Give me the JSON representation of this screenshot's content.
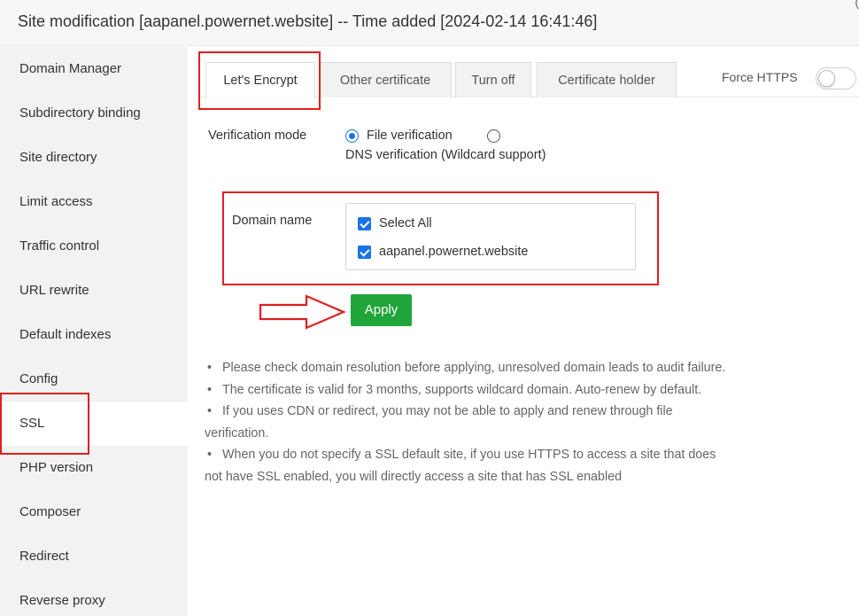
{
  "window": {
    "title": "Site modification [aapanel.powernet.website] -- Time added [2024-02-14 16:41:46]"
  },
  "sidebar": {
    "items": [
      {
        "label": "Domain Manager"
      },
      {
        "label": "Subdirectory binding"
      },
      {
        "label": "Site directory"
      },
      {
        "label": "Limit access"
      },
      {
        "label": "Traffic control"
      },
      {
        "label": "URL rewrite"
      },
      {
        "label": "Default indexes"
      },
      {
        "label": "Config"
      },
      {
        "label": "SSL",
        "active": true
      },
      {
        "label": "PHP version"
      },
      {
        "label": "Composer"
      },
      {
        "label": "Redirect"
      },
      {
        "label": "Reverse proxy"
      }
    ]
  },
  "tabs": [
    {
      "label": "Let's Encrypt",
      "active": true
    },
    {
      "label": "Other certificate"
    },
    {
      "label": "Turn off"
    },
    {
      "label": "Certificate holder"
    }
  ],
  "force_https": {
    "label": "Force HTTPS",
    "enabled": false
  },
  "verification": {
    "label": "Verification mode",
    "options": [
      {
        "label": "File verification",
        "checked": true
      },
      {
        "label": "DNS verification (Wildcard support)",
        "checked": false
      }
    ]
  },
  "domain": {
    "label": "Domain name",
    "options": [
      {
        "label": "Select All",
        "checked": true
      },
      {
        "label": "aapanel.powernet.website",
        "checked": true
      }
    ]
  },
  "apply_button": {
    "label": "Apply"
  },
  "notes": [
    "Please check domain resolution before applying, unresolved domain leads to audit failure.",
    "The certificate is valid for 3 months, supports wildcard domain. Auto-renew by default.",
    "If you uses CDN or redirect, you may not be able to apply and renew through file verification.",
    "When you do not specify a SSL default site, if you use HTTPS to access a site that does not have SSL enabled, you will directly access a site that has SSL enabled"
  ],
  "colors": {
    "accent_blue": "#1a73e8",
    "apply_green": "#20a53a",
    "annotation_red": "#e02020",
    "sidebar_bg": "#f2f2f2"
  }
}
